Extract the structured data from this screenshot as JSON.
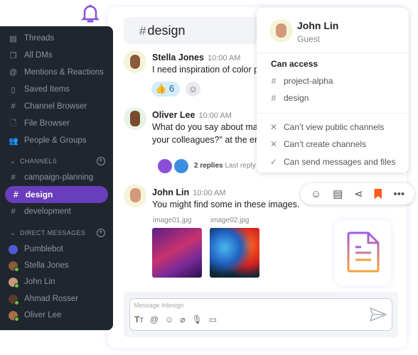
{
  "sidebar": {
    "items": [
      {
        "label": "Threads",
        "icon": "threads-icon"
      },
      {
        "label": "All DMs",
        "icon": "dms-icon"
      },
      {
        "label": "Mentions & Reactions",
        "icon": "at-icon"
      },
      {
        "label": "Saved Items",
        "icon": "bookmark-icon"
      },
      {
        "label": "Channel Browser",
        "icon": "channel-search-icon"
      },
      {
        "label": "File Browser",
        "icon": "file-search-icon"
      },
      {
        "label": "People & Groups",
        "icon": "people-icon"
      }
    ],
    "channels_label": "CHANNELS",
    "channels": [
      "campaign-planning",
      "design",
      "development"
    ],
    "active_channel": "design",
    "dm_label": "DIRECT MESSAGES",
    "dms": [
      "Pumblebot",
      "Stella Jones",
      "John Lin",
      "Ahmad Rosser",
      "Oliver Lee"
    ]
  },
  "header": {
    "channel": "design"
  },
  "messages": [
    {
      "author": "Stella Jones",
      "time": "10:00 AM",
      "text": "I need inspiration of color p",
      "reaction": "👍",
      "reaction_count": "6"
    },
    {
      "author": "Oliver Lee",
      "time": "10:00 AM",
      "text": "What do you say about mak",
      "text2": "your colleagues?\" at the en",
      "replies": "2 replies",
      "last_reply": "Last reply"
    },
    {
      "author": "John Lin",
      "time": "10:00 AM",
      "text": "You might find some in these images.",
      "images": [
        "image01.jpg",
        "image02.jpg"
      ]
    }
  ],
  "popover": {
    "name": "John Lin",
    "role": "Guest",
    "access_label": "Can access",
    "channels": [
      "project-alpha",
      "design"
    ],
    "permissions": [
      {
        "text": "Can’t view public channels",
        "allowed": false
      },
      {
        "text": "Can’t create channels",
        "allowed": false
      },
      {
        "text": "Can send messages and files",
        "allowed": true
      }
    ]
  },
  "composer": {
    "placeholder": "Message #design"
  },
  "colors": {
    "accent": "#6a3dbd",
    "sidebar": "#1f262d",
    "bookmark": "#ff5a1f"
  }
}
